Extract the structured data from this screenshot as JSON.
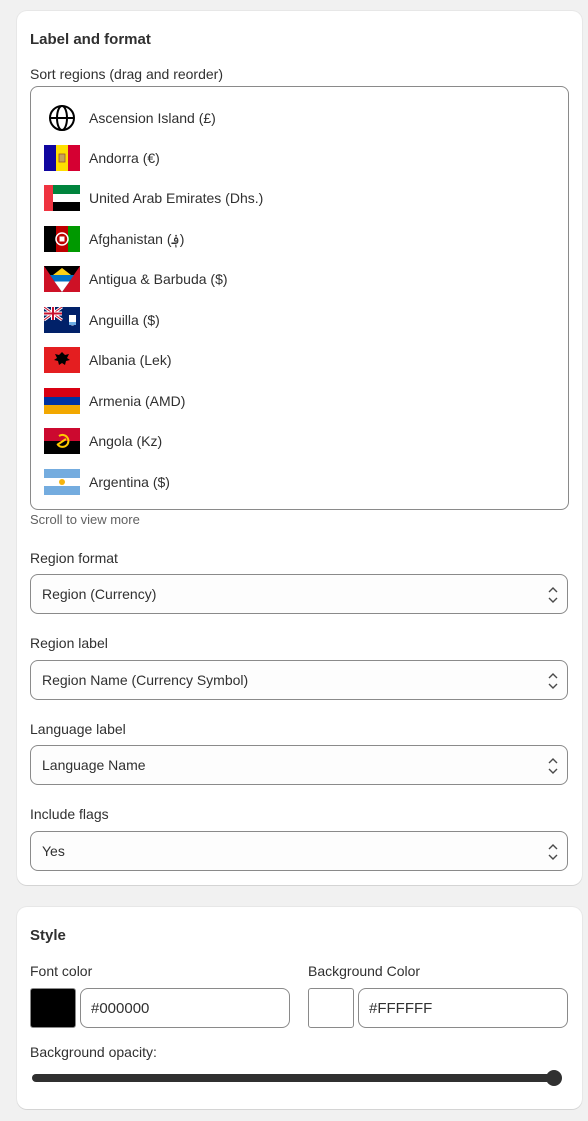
{
  "label_format": {
    "title": "Label and format",
    "sort_label": "Sort regions (drag and reorder)",
    "scroll_hint": "Scroll to view more",
    "regions": [
      {
        "name": "Ascension Island (£)",
        "flag": "globe-icon"
      },
      {
        "name": "Andorra (€)",
        "flag": "andorra-flag-icon"
      },
      {
        "name": "United Arab Emirates (Dhs.)",
        "flag": "uae-flag-icon"
      },
      {
        "name": "Afghanistan (؋)",
        "flag": "afghanistan-flag-icon"
      },
      {
        "name": "Antigua & Barbuda ($)",
        "flag": "antigua-barbuda-flag-icon"
      },
      {
        "name": "Anguilla ($)",
        "flag": "anguilla-flag-icon"
      },
      {
        "name": "Albania (Lek)",
        "flag": "albania-flag-icon"
      },
      {
        "name": "Armenia (AMD)",
        "flag": "armenia-flag-icon"
      },
      {
        "name": "Angola (Kz)",
        "flag": "angola-flag-icon"
      },
      {
        "name": "Argentina ($)",
        "flag": "argentina-flag-icon"
      }
    ],
    "region_format": {
      "label": "Region format",
      "value": "Region (Currency)"
    },
    "region_label": {
      "label": "Region label",
      "value": "Region Name (Currency Symbol)"
    },
    "language_label": {
      "label": "Language label",
      "value": "Language Name"
    },
    "include_flags": {
      "label": "Include flags",
      "value": "Yes"
    }
  },
  "style": {
    "title": "Style",
    "font_color": {
      "label": "Font color",
      "value": "#000000",
      "swatch": "#000000"
    },
    "background_color": {
      "label": "Background Color",
      "value": "#FFFFFF",
      "swatch": "#FFFFFF"
    },
    "opacity": {
      "label": "Background opacity:",
      "value": 1.0
    }
  },
  "colors": {
    "page_bg": "#f1f1f1",
    "card_bg": "#ffffff",
    "text": "#303030",
    "border": "#8a8a8a"
  }
}
